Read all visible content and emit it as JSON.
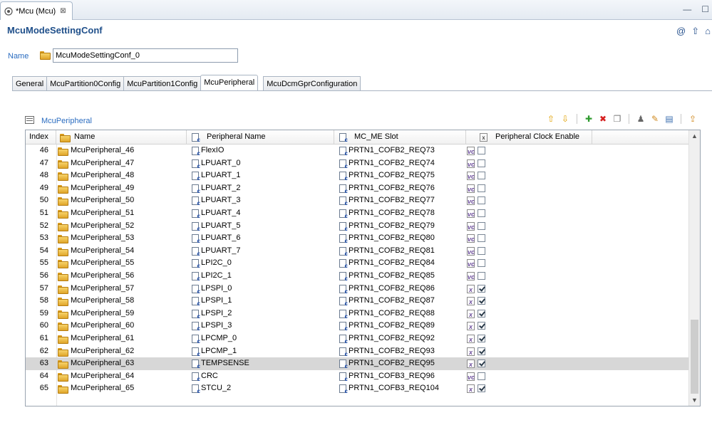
{
  "editor_tab": {
    "title": "*Mcu (Mcu)",
    "close": "⊠"
  },
  "window_controls": {
    "minimize": "—",
    "maximize": "☐"
  },
  "header": {
    "title": "McuModeSettingConf",
    "icons": [
      "at-icon",
      "up-arrow-icon",
      "home-icon"
    ]
  },
  "name_field": {
    "label": "Name",
    "value": "McuModeSettingConf_0"
  },
  "tabs": [
    {
      "label": "General"
    },
    {
      "label": "McuPartition0Config"
    },
    {
      "label": "McuPartition1Config"
    },
    {
      "label": "McuPeripheral"
    },
    {
      "label": "McuDcmGprConfiguration"
    }
  ],
  "active_tab": "McuPeripheral",
  "section": {
    "title": "McuPeripheral"
  },
  "table": {
    "columns": {
      "index": "Index",
      "name": "Name",
      "peripheral": "Peripheral Name",
      "slot": "MC_ME Slot",
      "clock": "Peripheral Clock Enable"
    },
    "rows": [
      {
        "index": "46",
        "name": "McuPeripheral_46",
        "peripheral": "FlexIO",
        "slot": "PRTN1_COFB2_REQ73",
        "clock": false
      },
      {
        "index": "47",
        "name": "McuPeripheral_47",
        "peripheral": "LPUART_0",
        "slot": "PRTN1_COFB2_REQ74",
        "clock": false
      },
      {
        "index": "48",
        "name": "McuPeripheral_48",
        "peripheral": "LPUART_1",
        "slot": "PRTN1_COFB2_REQ75",
        "clock": false
      },
      {
        "index": "49",
        "name": "McuPeripheral_49",
        "peripheral": "LPUART_2",
        "slot": "PRTN1_COFB2_REQ76",
        "clock": false
      },
      {
        "index": "50",
        "name": "McuPeripheral_50",
        "peripheral": "LPUART_3",
        "slot": "PRTN1_COFB2_REQ77",
        "clock": false
      },
      {
        "index": "51",
        "name": "McuPeripheral_51",
        "peripheral": "LPUART_4",
        "slot": "PRTN1_COFB2_REQ78",
        "clock": false
      },
      {
        "index": "52",
        "name": "McuPeripheral_52",
        "peripheral": "LPUART_5",
        "slot": "PRTN1_COFB2_REQ79",
        "clock": false
      },
      {
        "index": "53",
        "name": "McuPeripheral_53",
        "peripheral": "LPUART_6",
        "slot": "PRTN1_COFB2_REQ80",
        "clock": false
      },
      {
        "index": "54",
        "name": "McuPeripheral_54",
        "peripheral": "LPUART_7",
        "slot": "PRTN1_COFB2_REQ81",
        "clock": false
      },
      {
        "index": "55",
        "name": "McuPeripheral_55",
        "peripheral": "LPI2C_0",
        "slot": "PRTN1_COFB2_REQ84",
        "clock": false
      },
      {
        "index": "56",
        "name": "McuPeripheral_56",
        "peripheral": "LPI2C_1",
        "slot": "PRTN1_COFB2_REQ85",
        "clock": false
      },
      {
        "index": "57",
        "name": "McuPeripheral_57",
        "peripheral": "LPSPI_0",
        "slot": "PRTN1_COFB2_REQ86",
        "clock": true
      },
      {
        "index": "58",
        "name": "McuPeripheral_58",
        "peripheral": "LPSPI_1",
        "slot": "PRTN1_COFB2_REQ87",
        "clock": true
      },
      {
        "index": "59",
        "name": "McuPeripheral_59",
        "peripheral": "LPSPI_2",
        "slot": "PRTN1_COFB2_REQ88",
        "clock": true
      },
      {
        "index": "60",
        "name": "McuPeripheral_60",
        "peripheral": "LPSPI_3",
        "slot": "PRTN1_COFB2_REQ89",
        "clock": true
      },
      {
        "index": "61",
        "name": "McuPeripheral_61",
        "peripheral": "LPCMP_0",
        "slot": "PRTN1_COFB2_REQ92",
        "clock": true
      },
      {
        "index": "62",
        "name": "McuPeripheral_62",
        "peripheral": "LPCMP_1",
        "slot": "PRTN1_COFB2_REQ93",
        "clock": true
      },
      {
        "index": "63",
        "name": "McuPeripheral_63",
        "peripheral": "TEMPSENSE",
        "slot": "PRTN1_COFB2_REQ95",
        "clock": true,
        "selected": true
      },
      {
        "index": "64",
        "name": "McuPeripheral_64",
        "peripheral": "CRC",
        "slot": "PRTN1_COFB3_REQ96",
        "clock": false
      },
      {
        "index": "65",
        "name": "McuPeripheral_65",
        "peripheral": "STCU_2",
        "slot": "PRTN1_COFB3_REQ104",
        "clock": true
      }
    ]
  },
  "colors": {
    "title": "#1f4f8a",
    "link_label": "#2a6cc0",
    "selected_row": "#d7d7d7"
  }
}
